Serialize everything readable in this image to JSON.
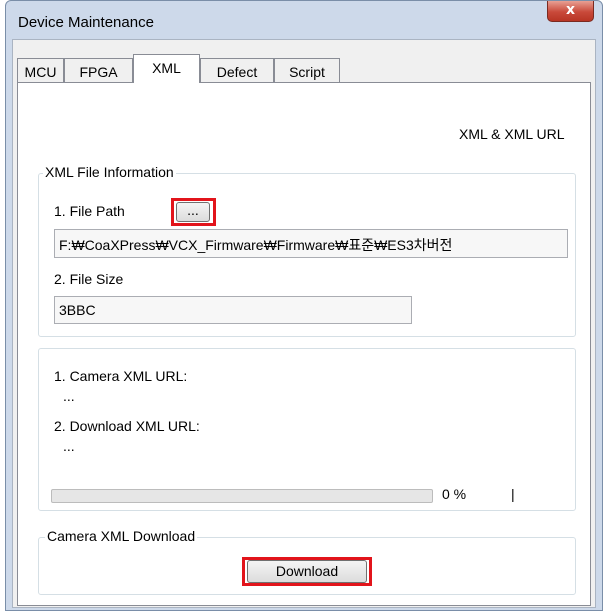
{
  "window": {
    "title": "Device Maintenance",
    "close_glyph": "x"
  },
  "tabs": [
    {
      "label": "MCU"
    },
    {
      "label": "FPGA"
    },
    {
      "label": "XML"
    },
    {
      "label": "Defect"
    },
    {
      "label": "Script"
    }
  ],
  "active_tab": "XML",
  "header_label": "XML & XML URL",
  "file_info": {
    "legend": "XML File Information",
    "file_path_label": "1. File Path",
    "browse_button": "...",
    "file_path_value": "F:₩CoaXPress₩VCX_Firmware₩Firmware₩표준₩ES3차버전",
    "file_size_label": "2. File Size",
    "file_size_value": "3BBC"
  },
  "urls": {
    "camera_label": "1. Camera XML URL:",
    "camera_value": "...",
    "download_label": "2. Download XML URL:",
    "download_value": "..."
  },
  "progress": {
    "percent_text": "0 %",
    "value": 0,
    "cursor": "|"
  },
  "download_group": {
    "legend": "Camera XML Download",
    "button": "Download"
  },
  "highlight_color": "#e2141b"
}
